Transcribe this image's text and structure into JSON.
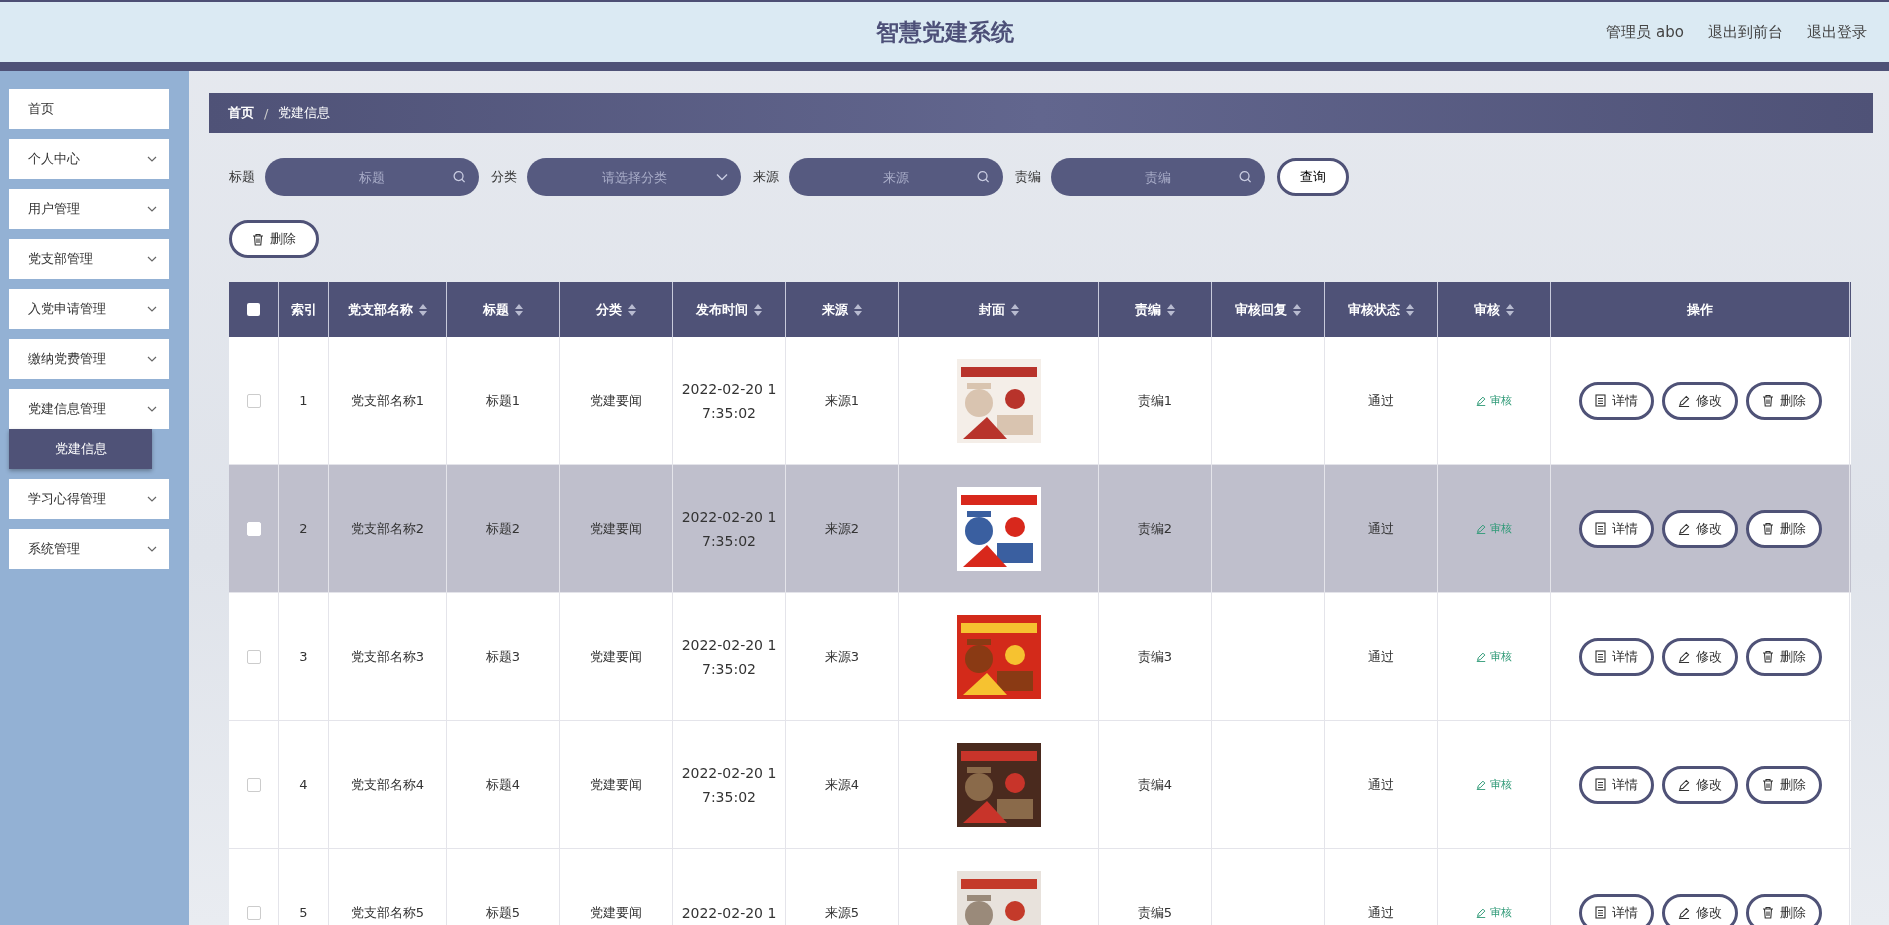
{
  "header": {
    "title": "智慧党建系统",
    "links": [
      "管理员 abo",
      "退出到前台",
      "退出登录"
    ]
  },
  "sidebar": {
    "items": [
      {
        "label": "首页",
        "expandable": false
      },
      {
        "label": "个人中心",
        "expandable": true
      },
      {
        "label": "用户管理",
        "expandable": true
      },
      {
        "label": "党支部管理",
        "expandable": true
      },
      {
        "label": "入党申请管理",
        "expandable": true
      },
      {
        "label": "缴纳党费管理",
        "expandable": true
      },
      {
        "label": "党建信息管理",
        "expandable": true,
        "children": [
          {
            "label": "党建信息",
            "selected": true
          }
        ]
      },
      {
        "label": "学习心得管理",
        "expandable": true
      },
      {
        "label": "系统管理",
        "expandable": true
      }
    ]
  },
  "breadcrumb": {
    "items": [
      "首页",
      "党建信息"
    ],
    "separator": "/"
  },
  "search": {
    "fields": [
      {
        "label": "标题",
        "placeholder": "标题",
        "kind": "text"
      },
      {
        "label": "分类",
        "placeholder": "请选择分类",
        "kind": "select"
      },
      {
        "label": "来源",
        "placeholder": "来源",
        "kind": "text"
      },
      {
        "label": "责编",
        "placeholder": "责编",
        "kind": "text"
      }
    ],
    "button": "查询"
  },
  "delete_button": "删除",
  "table": {
    "select_all_checked": false,
    "columns": [
      {
        "kind": "checkbox",
        "sortable": false
      },
      {
        "label": "索引",
        "kind": "text",
        "sortable": false
      },
      {
        "label": "党支部名称",
        "kind": "text",
        "sortable": true
      },
      {
        "label": "标题",
        "kind": "text",
        "sortable": true
      },
      {
        "label": "分类",
        "kind": "text",
        "sortable": true
      },
      {
        "label": "发布时间",
        "kind": "text",
        "sortable": true
      },
      {
        "label": "来源",
        "kind": "text",
        "sortable": true
      },
      {
        "label": "封面",
        "kind": "picture",
        "sortable": true
      },
      {
        "label": "责编",
        "kind": "text",
        "sortable": true
      },
      {
        "label": "审核回复",
        "kind": "text",
        "sortable": true
      },
      {
        "label": "审核状态",
        "kind": "text",
        "sortable": true
      },
      {
        "label": "审核",
        "kind": "review",
        "sortable": true
      },
      {
        "label": "操作",
        "kind": "actions",
        "sortable": false
      }
    ],
    "rows": [
      {
        "index": "1",
        "branch": "党支部名称1",
        "title": "标题1",
        "category": "党建要闻",
        "time": "2022-02-20 17:35:02",
        "source": "来源1",
        "cover": {
          "kind": "picture"
        },
        "editor": "责编1",
        "status": "通过",
        "review": "审核",
        "actions": [
          "详情",
          "修改",
          "删除"
        ],
        "selected": false,
        "checked": false
      },
      {
        "index": "2",
        "branch": "党支部名称2",
        "title": "标题2",
        "category": "党建要闻",
        "time": "2022-02-20 17:35:02",
        "source": "来源2",
        "cover": {
          "kind": "picture"
        },
        "editor": "责编2",
        "status": "通过",
        "review": "审核",
        "actions": [
          "详情",
          "修改",
          "删除"
        ],
        "selected": true,
        "checked": false
      },
      {
        "index": "3",
        "branch": "党支部名称3",
        "title": "标题3",
        "category": "党建要闻",
        "time": "2022-02-20 17:35:02",
        "source": "来源3",
        "cover": {
          "kind": "picture"
        },
        "editor": "责编3",
        "status": "通过",
        "review": "审核",
        "actions": [
          "详情",
          "修改",
          "删除"
        ],
        "selected": false,
        "checked": false
      },
      {
        "index": "4",
        "branch": "党支部名称4",
        "title": "标题4",
        "category": "党建要闻",
        "time": "2022-02-20 17:35:02",
        "source": "来源4",
        "cover": {
          "kind": "picture"
        },
        "editor": "责编4",
        "status": "通过",
        "review": "审核",
        "actions": [
          "详情",
          "修改",
          "删除"
        ],
        "selected": false,
        "checked": false
      },
      {
        "index": "5",
        "branch": "党支部名称5",
        "title": "标题5",
        "category": "党建要闻",
        "time": "2022-02-20 1",
        "source": "来源5",
        "cover": {
          "kind": "picture"
        },
        "editor": "责编5",
        "status": "通过",
        "review": "审核",
        "actions": [
          "详情",
          "修改",
          "删除"
        ],
        "selected": false,
        "checked": false
      }
    ]
  }
}
